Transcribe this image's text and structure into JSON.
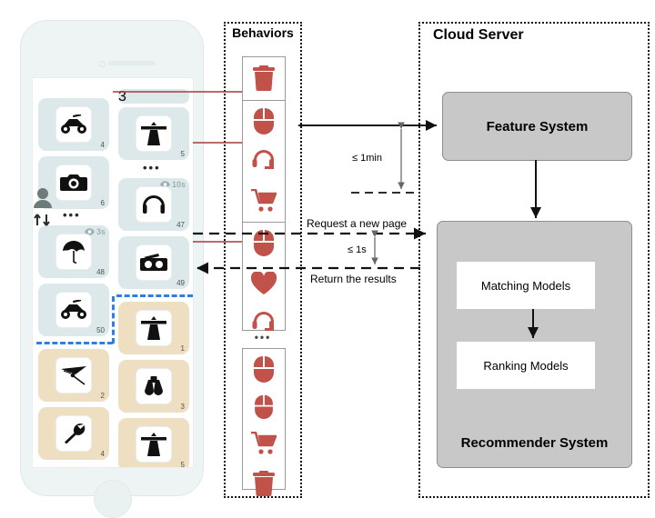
{
  "diagram": {
    "panels": {
      "behaviors_title": "Behaviors",
      "cloud_title": "Cloud Server"
    },
    "cloud": {
      "feature_system": "Feature System",
      "recommender_system": "Recommender System",
      "matching_models": "Matching Models",
      "ranking_models": "Ranking Models"
    },
    "arrows": {
      "latency_upload": "≤ 1min",
      "latency_request": "≤ 1s",
      "request": "Request a new page",
      "response": "Return the results"
    },
    "colors": {
      "behavior_red": "#c0524a",
      "tile_grey": "#dde8ea",
      "tile_beige": "#eedfc2",
      "block_grey": "#c8c8c8",
      "blue_dash": "#2f7fe0",
      "red_connector": "#a33c3c"
    },
    "phone": {
      "left_column": [
        {
          "num": "4",
          "icon": "quad-bike-icon",
          "style": "grey",
          "badge": null
        },
        {
          "num": "6",
          "icon": "camera-icon",
          "style": "grey",
          "badge": null
        },
        {
          "num": "48",
          "icon": "umbrella-icon",
          "style": "grey",
          "badge": "3s"
        },
        {
          "num": "50",
          "icon": "quad-bike-icon",
          "style": "grey",
          "badge": null
        },
        {
          "num": "2",
          "icon": "hang-glider-icon",
          "style": "beige",
          "badge": null
        },
        {
          "num": "4",
          "icon": "wrench-icon",
          "style": "beige",
          "badge": null
        }
      ],
      "right_column": [
        {
          "num": "3",
          "icon": "partial-tile",
          "style": "grey",
          "badge": null
        },
        {
          "num": "5",
          "icon": "lighthouse-icon",
          "style": "grey",
          "badge": null
        },
        {
          "num": "47",
          "icon": "headphones-icon",
          "style": "grey",
          "badge": "10s"
        },
        {
          "num": "49",
          "icon": "radio-icon",
          "style": "grey",
          "badge": null
        },
        {
          "num": "1",
          "icon": "lighthouse-icon",
          "style": "beige",
          "badge": null
        },
        {
          "num": "3",
          "icon": "binoculars-icon",
          "style": "beige",
          "badge": null
        },
        {
          "num": "5",
          "icon": "lighthouse-icon",
          "style": "beige",
          "badge": null
        }
      ],
      "user_icon": "user-scroll-icon",
      "ellipsis": "•••"
    },
    "behaviors": {
      "groups": [
        {
          "icons": [
            "trash-icon"
          ]
        },
        {
          "icons": [
            "mouse-click-icon",
            "headset-icon",
            "shopping-cart-icon"
          ]
        },
        {
          "icons": [
            "mouse-click-icon",
            "heart-icon",
            "headset-icon"
          ]
        },
        {
          "icons": [
            "mouse-click-icon",
            "mouse-click-icon",
            "shopping-cart-icon",
            "trash-icon"
          ]
        }
      ],
      "ellipsis": "•••"
    }
  }
}
